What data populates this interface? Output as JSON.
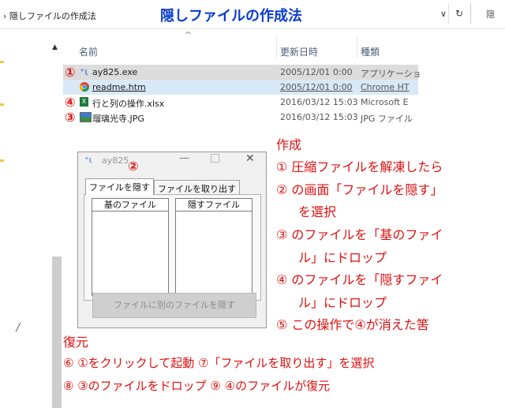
{
  "address_bar": {
    "path": "› 隠しファイルの作成法",
    "overlay_title": "隠しファイルの作成法",
    "dropdown": "∨",
    "refresh": "↻",
    "search": "隠"
  },
  "columns": {
    "name": "名前",
    "date": "更新日時",
    "type": "種類"
  },
  "files": [
    {
      "num": "①",
      "name": "ay825.exe",
      "date": "2005/12/01 0:00",
      "type": "アプリケーショ"
    },
    {
      "num": "",
      "name": "readme.htm",
      "date": "2005/12/01 0:00",
      "type": "Chrome HT"
    },
    {
      "num": "④",
      "name": "行と列の操作.xlsx",
      "date": "2016/03/12 15:03",
      "type": "Microsoft E"
    },
    {
      "num": "③",
      "name": "瑠璃光寺.JPG",
      "date": "2016/03/12 15:03",
      "type": "JPG ファイル"
    }
  ],
  "dialog": {
    "title": "ay825",
    "num": "②",
    "minimize": "—",
    "close": "✕",
    "tabs": [
      "ファイルを隠す",
      "ファイルを取り出す"
    ],
    "list_left": "基のファイル",
    "list_right": "隠すファイル",
    "button": "ファイルに別のファイルを隠す"
  },
  "annotations": {
    "create_heading": "作成",
    "create_steps": [
      "① 圧縮ファイルを解凍したら",
      "② の画面「ファイルを隠す」",
      "を選択",
      "③ のファイルを「基のファイ",
      "ル」にドロップ",
      "④ のファイルを「隠すファイ",
      "ル」にドロップ",
      "⑤ この操作で④が消えた筈"
    ],
    "restore_heading": "復元",
    "restore_line1": "⑥ ①をクリックして起動 ⑦「ファイルを取り出す」を選択",
    "restore_line2": "⑧ ③のファイルをドロップ ⑨ ④のファイルが復元"
  },
  "colors": {
    "annotation_red": "#e01010",
    "title_blue": "#0a3cd0",
    "selection": "#dcdcdc"
  }
}
